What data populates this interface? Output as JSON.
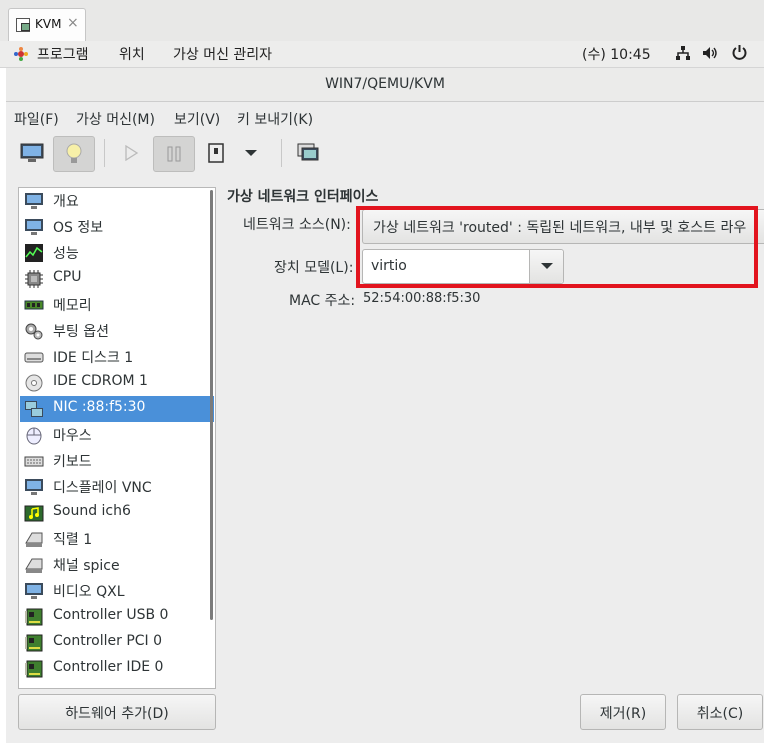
{
  "browser_tab": {
    "title": "KVM",
    "close": "×"
  },
  "panel": {
    "menus": [
      "프로그램",
      "위치",
      "가상 머신 관리자"
    ],
    "clock": "(수) 10:45"
  },
  "window": {
    "title": "WIN7/QEMU/KVM"
  },
  "menubar": [
    "파일(F)",
    "가상 머신(M)",
    "보기(V)",
    "키 보내기(K)"
  ],
  "toolbar": {
    "icons": [
      "console-icon",
      "details-lightbulb-icon",
      "run-icon",
      "pause-icon",
      "shutdown-icon",
      "shutdown-menu-icon",
      "snapshot-icon"
    ]
  },
  "devices": [
    {
      "label": "개요",
      "icon": "monitor-icon"
    },
    {
      "label": "OS 정보",
      "icon": "monitor-icon"
    },
    {
      "label": "성능",
      "icon": "performance-icon"
    },
    {
      "label": "CPU",
      "icon": "cpu-icon"
    },
    {
      "label": "메모리",
      "icon": "memory-icon"
    },
    {
      "label": "부팅 옵션",
      "icon": "gears-icon"
    },
    {
      "label": "IDE 디스크 1",
      "icon": "disk-icon"
    },
    {
      "label": "IDE CDROM 1",
      "icon": "cdrom-icon"
    },
    {
      "label": "NIC :88:f5:30",
      "icon": "network-icon"
    },
    {
      "label": "마우스",
      "icon": "mouse-icon"
    },
    {
      "label": "키보드",
      "icon": "keyboard-icon"
    },
    {
      "label": "디스플레이 VNC",
      "icon": "monitor-icon"
    },
    {
      "label": "Sound ich6",
      "icon": "sound-icon"
    },
    {
      "label": "직렬 1",
      "icon": "serial-icon"
    },
    {
      "label": "채널 spice",
      "icon": "channel-icon"
    },
    {
      "label": "비디오 QXL",
      "icon": "monitor-icon"
    },
    {
      "label": "Controller USB 0",
      "icon": "controller-card-icon"
    },
    {
      "label": "Controller PCI 0",
      "icon": "controller-card-icon"
    },
    {
      "label": "Controller IDE 0",
      "icon": "controller-card-icon"
    }
  ],
  "selected_device": "NIC :88:f5:30",
  "nic_panel": {
    "heading": "가상 네트워크 인터페이스",
    "source_label": "네트워크 소스(N):",
    "source_value": "가상 네트워크 'routed' : 독립된 네트워크, 내부 및 호스트 라우",
    "model_label": "장치 모델(L):",
    "model_value": "virtio",
    "mac_label": "MAC 주소:",
    "mac_value": "52:54:00:88:f5:30"
  },
  "buttons": {
    "add_hardware": "하드웨어 추가(D)",
    "remove": "제거(R)",
    "cancel": "취소(C)"
  },
  "colors": {
    "highlight": "#e2141e",
    "selection": "#4a90d9"
  }
}
